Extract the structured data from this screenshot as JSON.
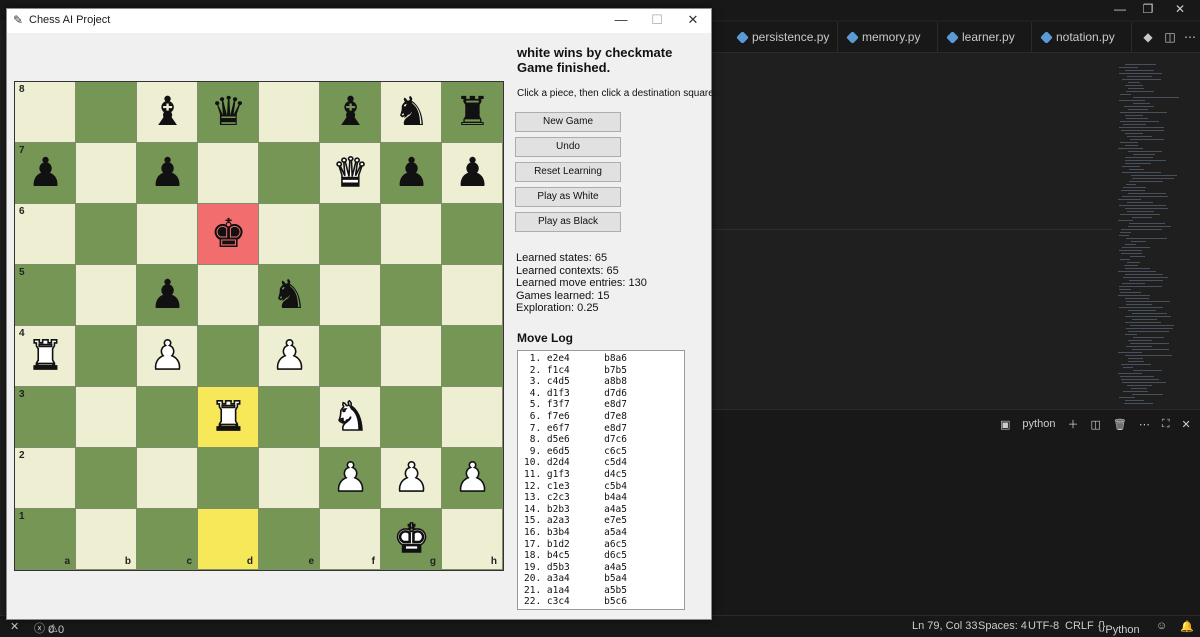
{
  "chess_window": {
    "title": "Chess AI Project",
    "status_line1": "white wins by checkmate",
    "status_line2": "Game finished.",
    "hint": "Click a piece, then click a destination square.",
    "buttons": [
      "New Game",
      "Undo",
      "Reset Learning",
      "Play as White",
      "Play as Black"
    ],
    "stats": [
      "Learned states: 65",
      "Learned contexts: 65",
      "Learned move entries: 130",
      "Games learned: 15",
      "Exploration: 0.25"
    ],
    "move_log_title": "Move Log",
    "moves": [
      [
        " 1.",
        "e2e4",
        "b8a6"
      ],
      [
        " 2.",
        "f1c4",
        "b7b5"
      ],
      [
        " 3.",
        "c4d5",
        "a8b8"
      ],
      [
        " 4.",
        "d1f3",
        "d7d6"
      ],
      [
        " 5.",
        "f3f7",
        "e8d7"
      ],
      [
        " 6.",
        "f7e6",
        "d7e8"
      ],
      [
        " 7.",
        "e6f7",
        "e8d7"
      ],
      [
        " 8.",
        "d5e6",
        "d7c6"
      ],
      [
        " 9.",
        "e6d5",
        "c6c5"
      ],
      [
        "10.",
        "d2d4",
        "c5d4"
      ],
      [
        "11.",
        "g1f3",
        "d4c5"
      ],
      [
        "12.",
        "c1e3",
        "c5b4"
      ],
      [
        "13.",
        "c2c3",
        "b4a4"
      ],
      [
        "14.",
        "b2b3",
        "a4a5"
      ],
      [
        "15.",
        "a2a3",
        "e7e5"
      ],
      [
        "16.",
        "b3b4",
        "a5a4"
      ],
      [
        "17.",
        "b1d2",
        "a6c5"
      ],
      [
        "18.",
        "b4c5",
        "d6c5"
      ],
      [
        "19.",
        "d5b3",
        "a4a5"
      ],
      [
        "20.",
        "a3a4",
        "b5a4"
      ],
      [
        "21.",
        "a1a4",
        "a5b5"
      ],
      [
        "22.",
        "c3c4",
        "b5c6"
      ]
    ],
    "board": {
      "files": [
        "a",
        "b",
        "c",
        "d",
        "e",
        "f",
        "g",
        "h"
      ],
      "ranks": [
        "8",
        "7",
        "6",
        "5",
        "4",
        "3",
        "2",
        "1"
      ],
      "rows": [
        [
          "",
          "",
          "bB",
          "bQ",
          "",
          "bB",
          "bN",
          "bR"
        ],
        [
          "bP",
          "",
          "bP",
          "",
          "",
          "wQ",
          "bP",
          "bP"
        ],
        [
          "",
          "",
          "",
          "bK",
          "",
          "",
          "",
          ""
        ],
        [
          "",
          "",
          "bP",
          "",
          "bN",
          "",
          "",
          ""
        ],
        [
          "wR",
          "",
          "wP",
          "",
          "wP",
          "",
          "",
          ""
        ],
        [
          "",
          "",
          "",
          "wR",
          "",
          "wN",
          "",
          ""
        ],
        [
          "",
          "",
          "",
          "",
          "",
          "wP",
          "wP",
          "wP"
        ],
        [
          "",
          "",
          "",
          "",
          "",
          "",
          "wK",
          ""
        ]
      ],
      "check_square": "d6",
      "last_move_squares": [
        "d3",
        "d1"
      ],
      "colors": {
        "light": "#eeeed2",
        "dark": "#769656",
        "check": "#f26d6d",
        "highlight": "#f7e85a"
      }
    }
  },
  "editor": {
    "tabs": [
      "persistence.py",
      "memory.py",
      "learner.py",
      "notation.py"
    ],
    "terminal_label": "python",
    "status": {
      "errors": "0",
      "warnings": "0",
      "position": "Ln 79, Col 33",
      "spaces": "Spaces: 4",
      "encoding": "UTF-8",
      "eol": "CRLF",
      "language": "Python"
    }
  }
}
